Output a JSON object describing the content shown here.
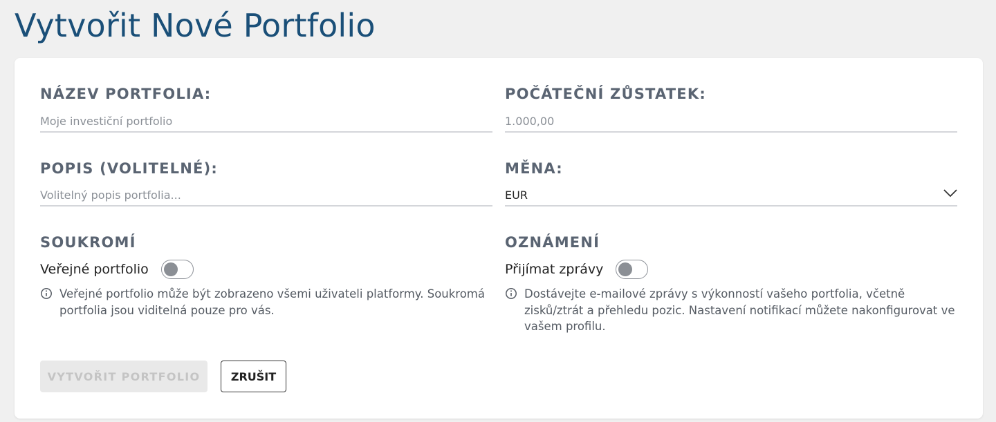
{
  "page": {
    "title": "Vytvořit Nové Portfolio"
  },
  "form": {
    "name": {
      "label": "NÁZEV PORTFOLIA:",
      "placeholder": "Moje investiční portfolio",
      "value": ""
    },
    "balance": {
      "label": "POČÁTEČNÍ ZŮSTATEK:",
      "placeholder": "1.000,00",
      "value": ""
    },
    "description": {
      "label": "POPIS (VOLITELNÉ):",
      "placeholder": "Volitelný popis portfolia...",
      "value": ""
    },
    "currency": {
      "label": "MĚNA:",
      "selected": "EUR",
      "icon": "chevron-down-icon"
    },
    "privacy": {
      "heading": "SOUKROMÍ",
      "toggle_label": "Veřejné portfolio",
      "enabled": false,
      "hint": "Veřejné portfolio může být zobrazeno všemi uživateli platformy. Soukromá portfolia jsou viditelná pouze pro vás."
    },
    "notifications": {
      "heading": "OZNÁMENÍ",
      "toggle_label": "Přijímat zprávy",
      "enabled": false,
      "hint": "Dostávejte e-mailové zprávy s výkonností vašeho portfolia, včetně zisků/ztrát a přehledu pozic. Nastavení notifikací můžete nakonfigurovat ve vašem profilu."
    }
  },
  "actions": {
    "create_label": "VYTVOŘIT PORTFOLIO",
    "create_disabled": true,
    "cancel_label": "ZRUŠIT"
  },
  "colors": {
    "title": "#1a4f78",
    "label": "#5a6472",
    "disabled_button_bg": "#e9e9e9",
    "disabled_button_text": "#c4c4c4"
  }
}
